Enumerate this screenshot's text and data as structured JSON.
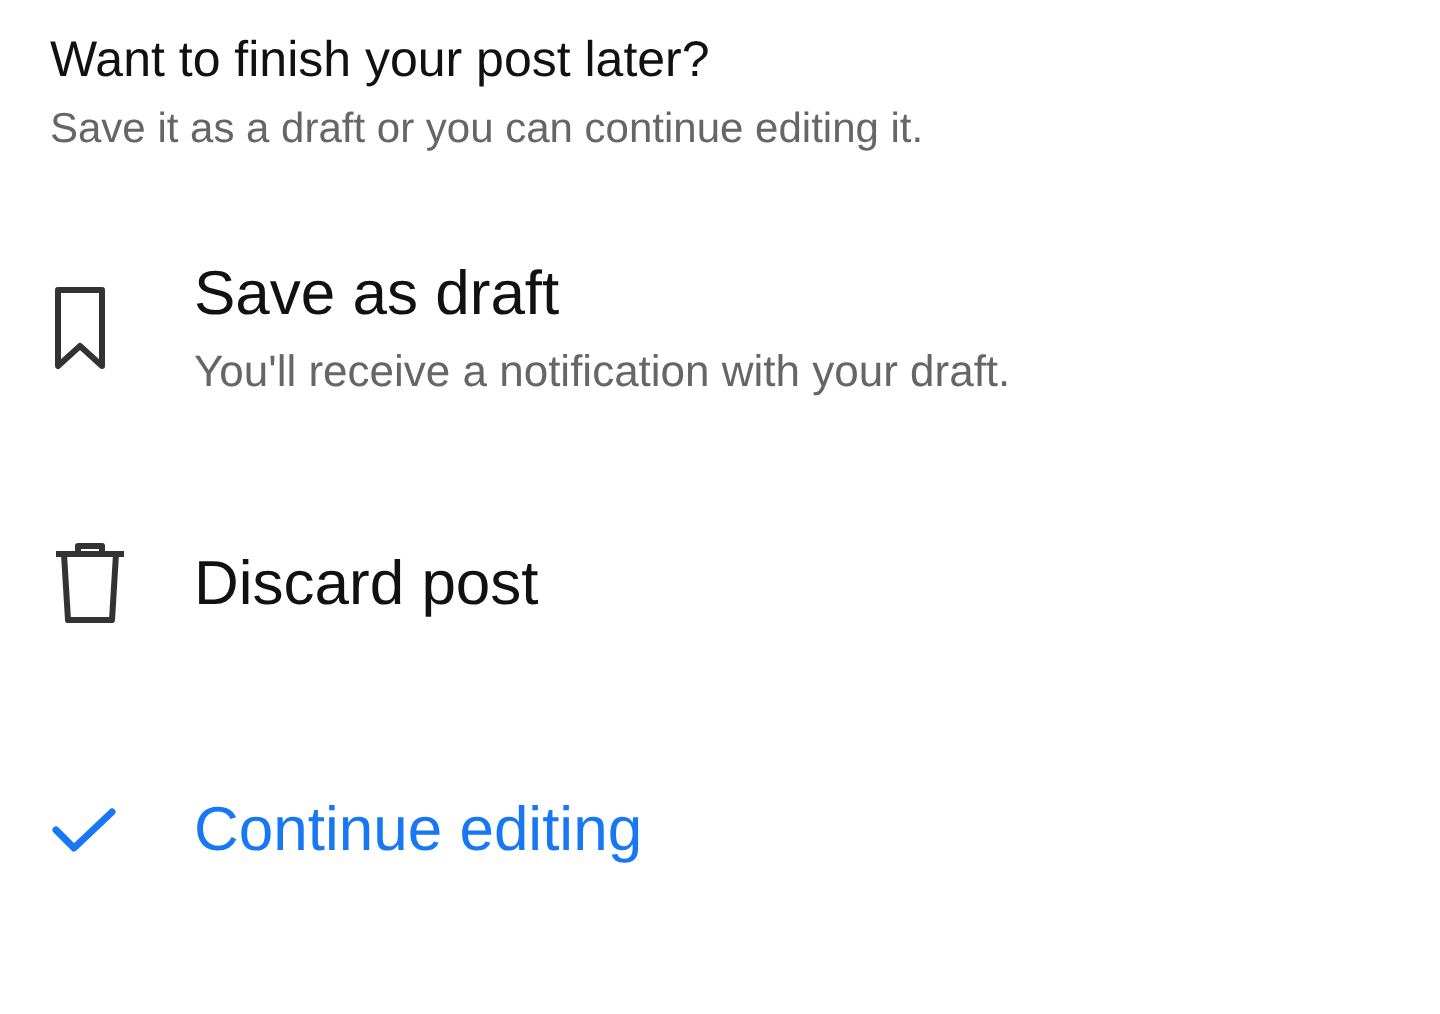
{
  "title": "Want to finish your post later?",
  "subtitle": "Save it as a draft or you can continue editing it.",
  "options": [
    {
      "kind": "bookmark",
      "label": "Save as draft",
      "description": "You'll receive a notification with your draft."
    },
    {
      "kind": "trash",
      "label": "Discard post"
    },
    {
      "kind": "check",
      "label": "Continue editing"
    }
  ]
}
